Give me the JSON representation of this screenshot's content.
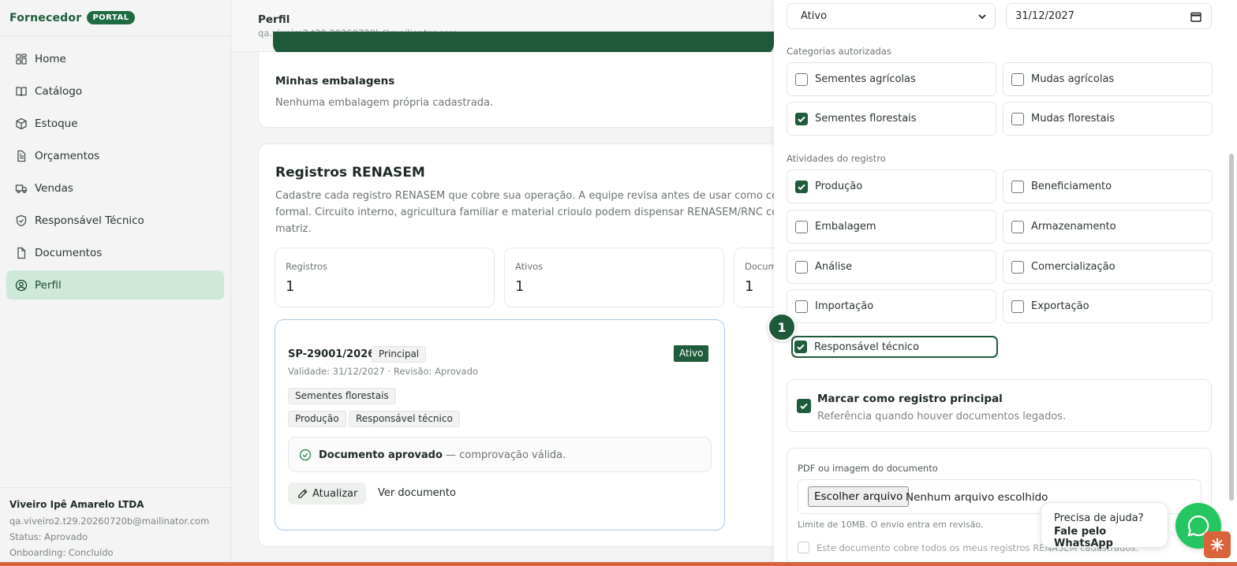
{
  "brand": {
    "name": "Fornecedor",
    "badge": "PORTAL"
  },
  "nav": [
    {
      "label": "Home",
      "icon": "grid-icon"
    },
    {
      "label": "Catálogo",
      "icon": "book-open-icon"
    },
    {
      "label": "Estoque",
      "icon": "package-icon"
    },
    {
      "label": "Orçamentos",
      "icon": "file-text-icon"
    },
    {
      "label": "Vendas",
      "icon": "truck-icon"
    },
    {
      "label": "Responsável Técnico",
      "icon": "shield-icon"
    },
    {
      "label": "Documentos",
      "icon": "file-icon"
    },
    {
      "label": "Perfil",
      "icon": "user-circle-icon",
      "active": true
    }
  ],
  "user": {
    "company": "Viveiro Ipê Amarelo LTDA",
    "email": "qa.viveiro2.t29.20260720b@mailinator.com",
    "status": "Status: Aprovado",
    "onboarding": "Onboarding: Concluído"
  },
  "header": {
    "title": "Perfil",
    "email": "qa.viveiro2.t29.20260720b@mailinator.com"
  },
  "packaging": {
    "title": "Minhas embalagens",
    "empty": "Nenhuma embalagem própria cadastrada."
  },
  "renasem": {
    "title": "Registros RENASEM",
    "description": "Cadastre cada registro RENASEM que cobre sua operação. A equipe revisa antes de usar como comp formal. Circuito interno, agricultura familiar e material crioulo podem dispensar RENASEM/RNC confo matriz.",
    "stats": [
      {
        "label": "Registros",
        "value": "1"
      },
      {
        "label": "Ativos",
        "value": "1"
      },
      {
        "label": "Docum",
        "value": "1"
      }
    ],
    "record": {
      "id": "SP-29001/2026",
      "tag": "Principal",
      "status": "Ativo",
      "meta": "Validade: 31/12/2027 · Revisão: Aprovado",
      "categories": [
        "Sementes florestais"
      ],
      "activities": [
        "Produção",
        "Responsável técnico"
      ],
      "doc_status_bold": "Documento aprovado",
      "doc_status_rest": " — comprovação válida.",
      "update_label": "Atualizar",
      "view_label": "Ver documento"
    }
  },
  "panel": {
    "status_select": "Ativo",
    "validity_date": "31/12/2027",
    "categories_label": "Categorias autorizadas",
    "categories": [
      {
        "label": "Sementes agrícolas",
        "checked": false
      },
      {
        "label": "Mudas agrícolas",
        "checked": false
      },
      {
        "label": "Sementes florestais",
        "checked": true
      },
      {
        "label": "Mudas florestais",
        "checked": false
      }
    ],
    "activities_label": "Atividades do registro",
    "activities": [
      {
        "label": "Produção",
        "checked": true
      },
      {
        "label": "Beneficiamento",
        "checked": false
      },
      {
        "label": "Embalagem",
        "checked": false
      },
      {
        "label": "Armazenamento",
        "checked": false
      },
      {
        "label": "Análise",
        "checked": false
      },
      {
        "label": "Comercialização",
        "checked": false
      },
      {
        "label": "Importação",
        "checked": false
      },
      {
        "label": "Exportação",
        "checked": false
      },
      {
        "label": "Responsável técnico",
        "checked": true
      }
    ],
    "step_badge": "1",
    "principal_title": "Marcar como registro principal",
    "principal_sub": "Referência quando houver documentos legados.",
    "upload_label": "PDF ou imagem do documento",
    "file_button": "Escolher arquivo",
    "file_none": "Nenhum arquivo escolhido",
    "upload_hint": "Limite de 10MB. O envio entra em revisão.",
    "all_registers": "Este documento cobre todos os meus registros RENASEM cadastrados."
  },
  "help": {
    "question": "Precisa de ajuda?",
    "action": "Fale pelo WhatsApp"
  },
  "colors": {
    "brand_green": "#1f5c3b",
    "active_nav": "#cfe9d9",
    "whatsapp": "#25c661",
    "accent_orange": "#d9643a"
  }
}
